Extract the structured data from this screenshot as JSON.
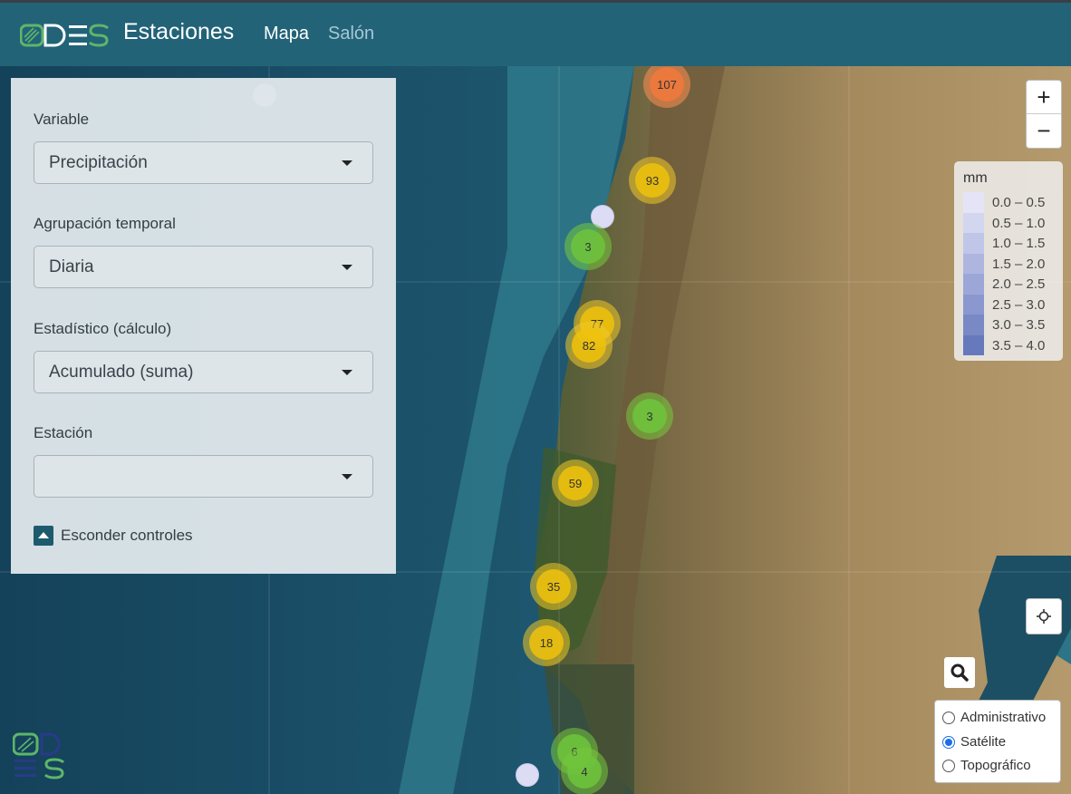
{
  "header": {
    "brand": "Estaciones",
    "nav": [
      {
        "label": "Mapa",
        "active": true
      },
      {
        "label": "Salón",
        "active": false
      }
    ]
  },
  "controls": {
    "variable_label": "Variable",
    "variable_value": "Precipitación",
    "grouping_label": "Agrupación temporal",
    "grouping_value": "Diaria",
    "statistic_label": "Estadístico (cálculo)",
    "statistic_value": "Acumulado (suma)",
    "station_label": "Estación",
    "station_value": "",
    "hide_label": "Esconder controles"
  },
  "map": {
    "zoom_in": "+",
    "zoom_out": "−",
    "clusters": [
      {
        "count": "107",
        "color": "orange"
      },
      {
        "count": "93",
        "color": "yellow"
      },
      {
        "count": "3",
        "color": "green"
      },
      {
        "count": "77",
        "color": "yellow"
      },
      {
        "count": "82",
        "color": "yellow"
      },
      {
        "count": "3",
        "color": "green"
      },
      {
        "count": "59",
        "color": "yellow"
      },
      {
        "count": "35",
        "color": "yellow"
      },
      {
        "count": "18",
        "color": "yellow"
      },
      {
        "count": "6",
        "color": "green"
      },
      {
        "count": "4",
        "color": "green"
      }
    ],
    "legend": {
      "title": "mm",
      "ranges": [
        "0.0 – 0.5",
        "0.5 – 1.0",
        "1.0 – 1.5",
        "1.5 – 2.0",
        "2.0 – 2.5",
        "2.5 – 3.0",
        "3.0 – 3.5",
        "3.5 – 4.0"
      ],
      "colors": [
        "#e4e4f6",
        "#d2d6ef",
        "#c0c6e8",
        "#aeb6e0",
        "#9ca7d8",
        "#8a98cf",
        "#7889c6",
        "#6679bd"
      ]
    },
    "base_layers": [
      {
        "label": "Administrativo",
        "selected": false
      },
      {
        "label": "Satélite",
        "selected": true
      },
      {
        "label": "Topográfico",
        "selected": false
      }
    ]
  },
  "colors": {
    "header_bg": "#226378",
    "logo_green": "#5fb56a"
  }
}
